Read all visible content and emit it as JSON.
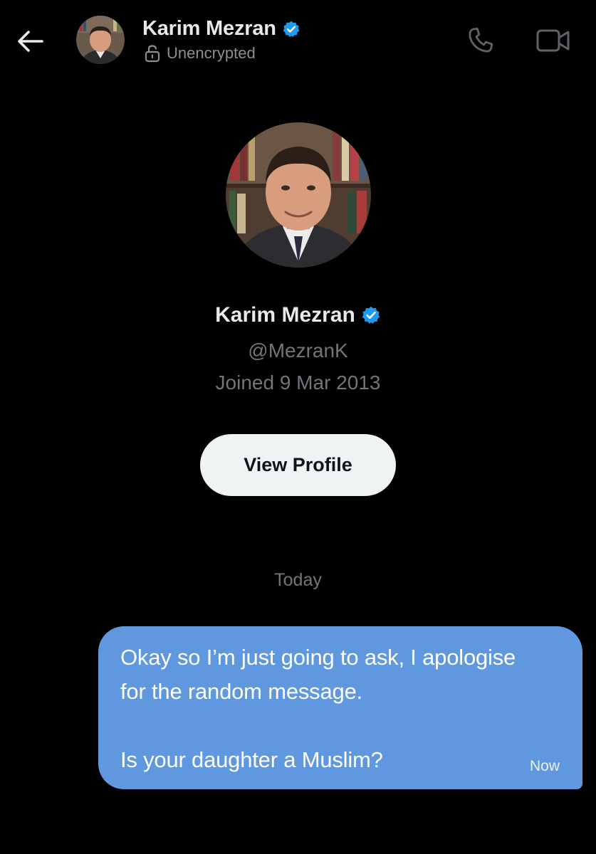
{
  "header": {
    "name": "Karim Mezran",
    "status": "Unencrypted",
    "avatar_icon": "person-avatar",
    "back_icon": "arrow-left-icon",
    "call_icon": "phone-icon",
    "video_icon": "video-camera-icon"
  },
  "profile": {
    "name": "Karim Mezran",
    "handle": "@MezranK",
    "joined": "Joined 9 Mar 2013",
    "view_profile_label": "View Profile",
    "verified_icon": "verified-badge-icon"
  },
  "conversation": {
    "date_divider": "Today",
    "messages": [
      {
        "direction": "outgoing",
        "text": "Okay so I’m just going to ask, I apologise\nfor the random message.\n\nIs your daughter a Muslim?",
        "time": "Now"
      }
    ]
  },
  "colors": {
    "background": "#000000",
    "outgoing_bubble": "#6098e0",
    "verified_blue": "#1d9bf0",
    "muted_text": "#71767b",
    "button_bg": "#eff3f4"
  }
}
